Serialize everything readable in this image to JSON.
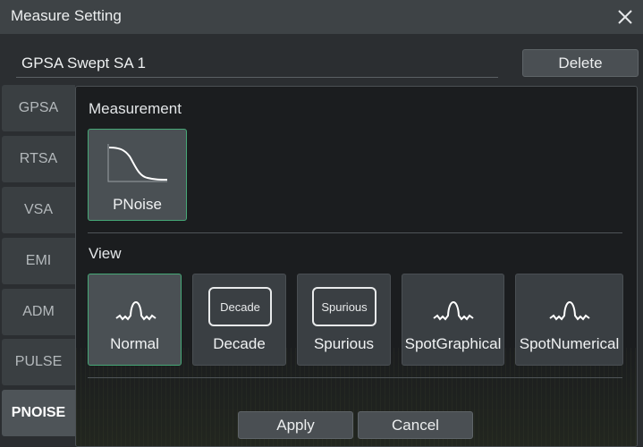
{
  "window": {
    "title": "Measure Setting"
  },
  "name_field": {
    "value": "GPSA Swept SA 1"
  },
  "delete_label": "Delete",
  "tabs": [
    {
      "label": "GPSA",
      "active": false
    },
    {
      "label": "RTSA",
      "active": false
    },
    {
      "label": "VSA",
      "active": false
    },
    {
      "label": "EMI",
      "active": false
    },
    {
      "label": "ADM",
      "active": false
    },
    {
      "label": "PULSE",
      "active": false
    },
    {
      "label": "PNOISE",
      "active": true
    }
  ],
  "measurement": {
    "heading": "Measurement",
    "items": [
      {
        "label": "PNoise",
        "icon": "phase-noise-curve-icon",
        "selected": true
      }
    ]
  },
  "view": {
    "heading": "View",
    "items": [
      {
        "label": "Normal",
        "icon": "spectrum-peak-icon",
        "selected": true
      },
      {
        "label": "Decade",
        "icon_text": "Decade",
        "selected": false
      },
      {
        "label": "Spurious",
        "icon_text": "Spurious",
        "selected": false
      },
      {
        "label": "SpotGraphical",
        "icon": "spectrum-peak-icon",
        "selected": false
      },
      {
        "label": "SpotNumerical",
        "icon": "spectrum-peak-icon",
        "selected": false
      }
    ]
  },
  "footer": {
    "apply_label": "Apply",
    "cancel_label": "Cancel"
  },
  "colors": {
    "accent": "#46a877",
    "titlebar": "#3e4346",
    "panel": "#1b1d1f"
  }
}
